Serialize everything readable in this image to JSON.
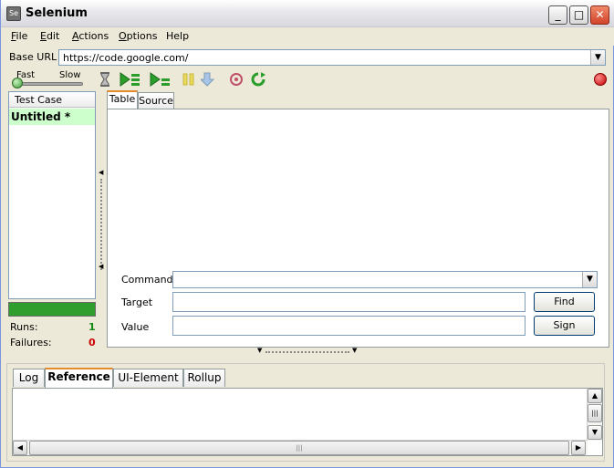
{
  "window": {
    "title": "Selenium",
    "app_icon": "Se",
    "minimize": "_",
    "maximize": "□",
    "close": "✕"
  },
  "menu": [
    {
      "mnemonic": "F",
      "rest": "ile"
    },
    {
      "mnemonic": "E",
      "rest": "dit"
    },
    {
      "mnemonic": "A",
      "rest": "ctions"
    },
    {
      "mnemonic": "O",
      "rest": "ptions"
    },
    {
      "mnemonic": "",
      "rest": "Help"
    }
  ],
  "base_url": {
    "label": "Base URL",
    "value": "https://code.google.com/"
  },
  "toolbar": {
    "speed_fast": "Fast",
    "speed_slow": "Slow",
    "icons": [
      "hourglass-icon",
      "play-all-icon",
      "play-current-icon",
      "pause-icon",
      "step-icon",
      "rollup-icon",
      "schedule-icon",
      "record-icon"
    ],
    "colors": {
      "play": "#2a9d2a",
      "pause": "#e8d95c",
      "record": "#cc0000"
    }
  },
  "test_case": {
    "header": "Test Case",
    "items": [
      "Untitled *"
    ]
  },
  "stats": {
    "runs_label": "Runs:",
    "runs": "1",
    "failures_label": "Failures:",
    "failures": "0"
  },
  "editor_tabs": [
    "Table",
    "Source"
  ],
  "command_form": {
    "command_label": "Command",
    "target_label": "Target",
    "value_label": "Value",
    "find_button": "Find",
    "sign_button": "Sign"
  },
  "bottom_tabs": [
    "Log",
    "Reference",
    "UI-Element",
    "Rollup"
  ],
  "scroll_glyphs": {
    "up": "▲",
    "down": "▼",
    "left": "◀",
    "right": "▶",
    "grip": "|||"
  }
}
